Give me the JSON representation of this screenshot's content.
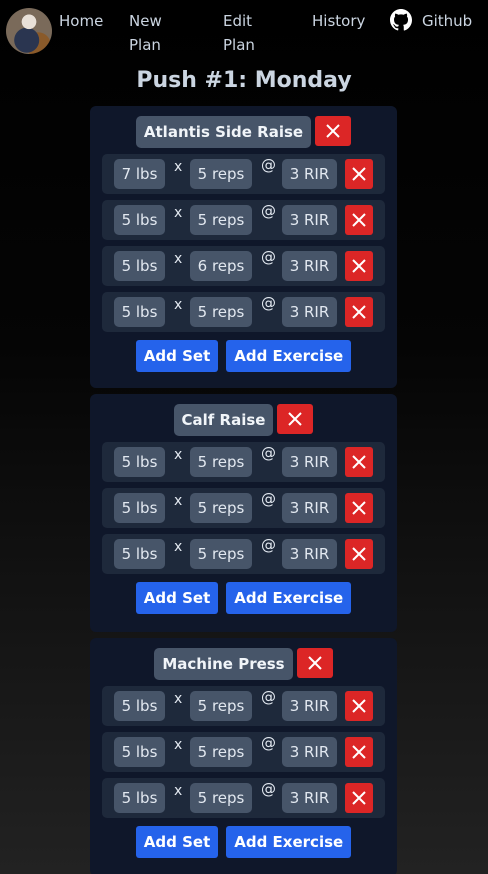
{
  "nav": {
    "home": "Home",
    "new_plan": "New Plan",
    "edit_plan": "Edit Plan",
    "history": "History",
    "github": "Github"
  },
  "title": "Push #1: Monday",
  "labels": {
    "x": "x",
    "at": "@",
    "add_set": "Add Set",
    "add_exercise": "Add Exercise"
  },
  "exercises": [
    {
      "name": "Atlantis Side Raise",
      "sets": [
        {
          "weight": "7 lbs",
          "reps": "5 reps",
          "rir": "3 RIR"
        },
        {
          "weight": "5 lbs",
          "reps": "5 reps",
          "rir": "3 RIR"
        },
        {
          "weight": "5 lbs",
          "reps": "6 reps",
          "rir": "3 RIR"
        },
        {
          "weight": "5 lbs",
          "reps": "5 reps",
          "rir": "3 RIR"
        }
      ]
    },
    {
      "name": "Calf Raise",
      "sets": [
        {
          "weight": "5 lbs",
          "reps": "5 reps",
          "rir": "3 RIR"
        },
        {
          "weight": "5 lbs",
          "reps": "5 reps",
          "rir": "3 RIR"
        },
        {
          "weight": "5 lbs",
          "reps": "5 reps",
          "rir": "3 RIR"
        }
      ]
    },
    {
      "name": "Machine Press",
      "sets": [
        {
          "weight": "5 lbs",
          "reps": "5 reps",
          "rir": "3 RIR"
        },
        {
          "weight": "5 lbs",
          "reps": "5 reps",
          "rir": "3 RIR"
        },
        {
          "weight": "5 lbs",
          "reps": "5 reps",
          "rir": "3 RIR"
        }
      ]
    }
  ]
}
